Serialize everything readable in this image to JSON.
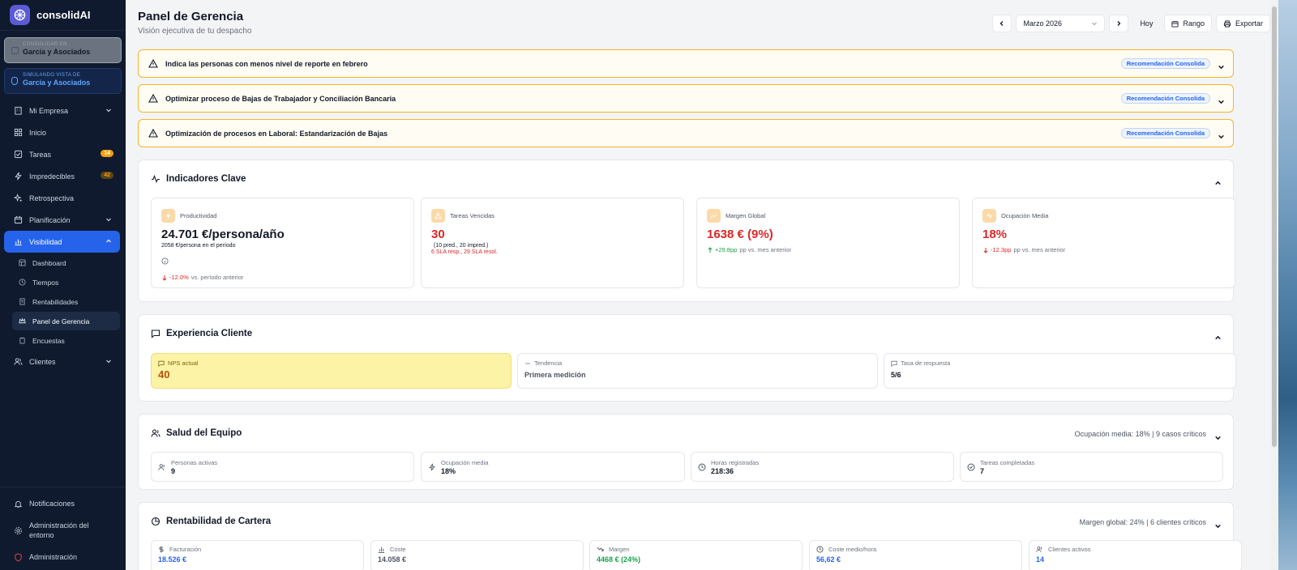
{
  "brand": {
    "name": "consolidAI"
  },
  "company": {
    "label": "CONSOLIDAR EN",
    "name": "García y Asociados"
  },
  "simulating": {
    "label": "SIMULANDO VISTA DE",
    "name": "García y Asociados"
  },
  "nav": {
    "mi_empresa": "Mi Empresa",
    "inicio": "Inicio",
    "tareas": "Tareas",
    "tareas_badge": "14",
    "impredecibles": "Impredecibles",
    "impredecibles_badge": "42",
    "retrospectiva": "Retrospectiva",
    "planificacion": "Planificación",
    "visibilidad": "Visibilidad",
    "sub": {
      "dashboard": "Dashboard",
      "tiempos": "Tiempos",
      "rentabilidades": "Rentabilidades",
      "panel": "Panel de Gerencia",
      "encuestas": "Encuestas"
    },
    "clientes": "Clientes",
    "notificaciones": "Notificaciones",
    "admin_entorno": "Administración del entorno",
    "administracion": "Administración"
  },
  "header": {
    "title": "Panel de Gerencia",
    "subtitle": "Visión ejecutiva de tu despacho"
  },
  "toolbar": {
    "month": "Marzo 2026",
    "today": "Hoy",
    "range": "Rango",
    "export": "Exportar"
  },
  "alerts": [
    {
      "text": "Indica las personas con menos nivel de reporte en febrero",
      "tag": "Recomendación Consolida"
    },
    {
      "text": "Optimizar proceso de Bajas de Trabajador y Conciliación Bancaria",
      "tag": "Recomendación Consolida"
    },
    {
      "text": "Optimización de procesos en Laboral: Estandarización de Bajas",
      "tag": "Recomendación Consolida"
    }
  ],
  "indicadores": {
    "title": "Indicadores Clave",
    "productividad": {
      "label": "Productividad",
      "value": "24.701 €/persona/año",
      "note": "2058 €/persona en el período",
      "delta": "-12.0%",
      "delta_suffix": "vs. período anterior"
    },
    "vencidas": {
      "label": "Tareas Vencidas",
      "value": "30",
      "note": "(10 pred., 20 impred.)",
      "note2": "6 SLA resp., 29 SLA resol."
    },
    "margen": {
      "label": "Margen Global",
      "value": "1638 € (9%)",
      "delta": "+29.8pp",
      "delta_suffix": "pp vs. mes anterior"
    },
    "ocupacion": {
      "label": "Ocupación Media",
      "value": "18%",
      "delta": "-12.3pp",
      "delta_suffix": "pp vs. mes anterior"
    }
  },
  "experiencia": {
    "title": "Experiencia Cliente",
    "nps_label": "NPS actual",
    "nps_value": "40",
    "tendencia_label": "Tendencia",
    "tendencia_value": "Primera medición",
    "tasa_label": "Tasa de respuesta",
    "tasa_value": "5/6"
  },
  "salud": {
    "title": "Salud del Equipo",
    "summary": "Ocupación media: 18% | 9 casos críticos",
    "stats": [
      {
        "label": "Personas activas",
        "value": "9"
      },
      {
        "label": "Ocupación media",
        "value": "18%"
      },
      {
        "label": "Horas registradas",
        "value": "218:36"
      },
      {
        "label": "Tareas completadas",
        "value": "7"
      }
    ]
  },
  "cartera": {
    "title": "Rentabilidad de Cartera",
    "summary": "Margen global: 24% | 6 clientes críticos",
    "stats": [
      {
        "label": "Facturación",
        "value": "18.526 €"
      },
      {
        "label": "Coste",
        "value": "14.058 €"
      },
      {
        "label": "Margen",
        "value": "4468 € (24%)"
      },
      {
        "label": "Coste medio/hora",
        "value": "56,62 €"
      },
      {
        "label": "Clientes activos",
        "value": "14"
      }
    ]
  },
  "colors": {
    "sidebar": "#0f1a2e",
    "accent": "#2563eb",
    "alert_border": "#f5b428",
    "negative": "#dc2626",
    "positive": "#16a34a",
    "nps_bg": "#fdf3a6"
  }
}
